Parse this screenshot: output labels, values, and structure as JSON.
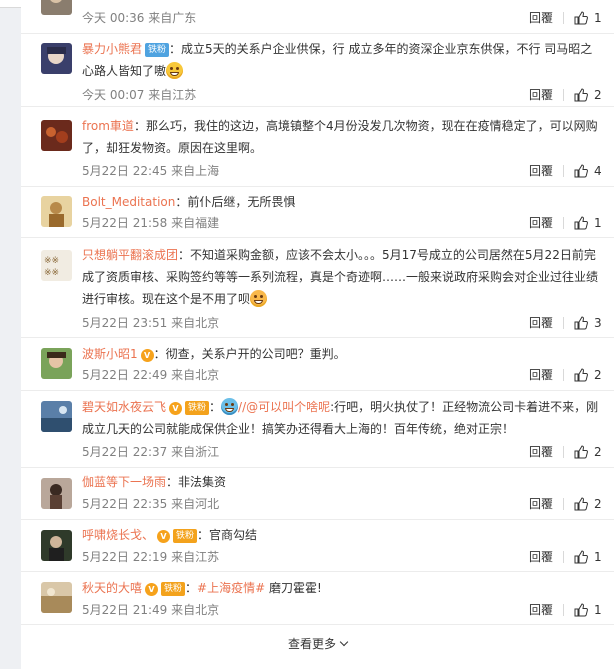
{
  "comments": [
    {
      "user": "",
      "content": "",
      "meta": "今天 00:36 来自广东",
      "reply": "回覆",
      "likes": "1"
    },
    {
      "user": "暴力小熊君",
      "badge": "铁粉",
      "content": "：成立5天的关系户企业供保，行 成立多年的资深企业京东供保，不行 司马昭之心路人皆知了嗷",
      "meta": "今天 00:07 来自江苏",
      "reply": "回覆",
      "likes": "2"
    },
    {
      "user": "from車道",
      "content": "：那么巧，我住的这边，高境镇整个4月份没发几次物资，现在在疫情稳定了，可以网购了，却狂发物资。原因在这里啊。",
      "meta": "5月22日 22:45 来自上海",
      "reply": "回覆",
      "likes": "4"
    },
    {
      "user": "Bolt_Meditation",
      "content": "：前仆后继，无所畏惧",
      "meta": "5月22日 21:58 来自福建",
      "reply": "回覆",
      "likes": "1"
    },
    {
      "user": "只想躺平翻滚成团",
      "content": "：不知道采购金额，应该不会太小。。。5月17号成立的公司居然在5月22日前完成了资质审核、采购签约等等一系列流程，真是个奇迹啊……一般来说政府采购会对企业过往业绩进行审核。现在这个是不用了呗",
      "meta": "5月22日 23:51 来自北京",
      "reply": "回覆",
      "likes": "3"
    },
    {
      "user": "波斯小昭1",
      "content": "：彻查，关系户开的公司吧？重判。",
      "meta": "5月22日 22:49 来自北京",
      "reply": "回覆",
      "likes": "2"
    },
    {
      "user": "碧天如水夜云飞",
      "badge": "铁粉",
      "content_prefix": "：",
      "mention": "//@可以叫个啥呢",
      "content": ":行吧，明火执仗了！正经物流公司卡着进不来，刚成立几天的公司就能成保供企业！搞笑办还得看大上海的！百年传统，绝对正宗！",
      "meta": "5月22日 22:37 来自浙江",
      "reply": "回覆",
      "likes": "2"
    },
    {
      "user": "伽蓝等下一场雨",
      "content": "：非法集资",
      "meta": "5月22日 22:35 来自河北",
      "reply": "回覆",
      "likes": "2"
    },
    {
      "user": "呼啸烧长戈、",
      "badge": "铁粉",
      "content": "：官商勾结",
      "meta": "5月22日 22:19 来自江苏",
      "reply": "回覆",
      "likes": "1"
    },
    {
      "user": "秋天的大嘻",
      "badge": "铁粉",
      "hashtag": "#上海疫情#",
      "content": " 磨刀霍霍!",
      "meta": "5月22日 21:49 来自北京",
      "reply": "回覆",
      "likes": "1"
    }
  ],
  "see_more": "查看更多",
  "vip_label": "V"
}
